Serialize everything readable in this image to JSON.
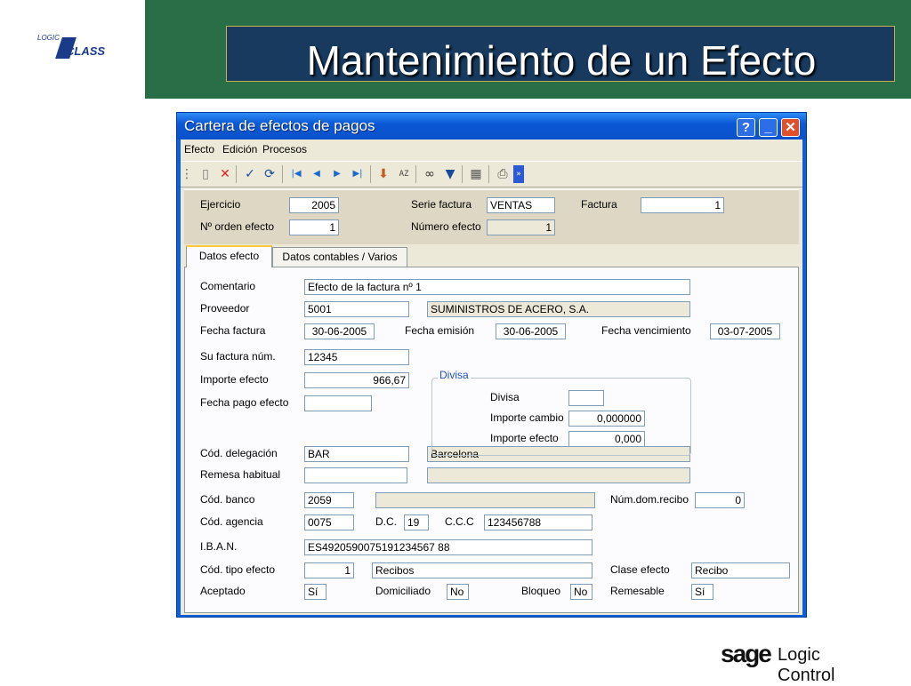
{
  "slide": {
    "title": "Mantenimiento de un Efecto"
  },
  "logo_top": {
    "logic": "LOGIC",
    "class": "CLASS"
  },
  "logo_bottom": {
    "sage": "sage",
    "logic_control": "Logic Control"
  },
  "window": {
    "title": "Cartera de efectos de pagos",
    "help": "?",
    "minimize": "_",
    "close": "✕"
  },
  "menu": [
    "Efecto",
    "Edición",
    "Procesos"
  ],
  "toolbar_icons": [
    "new-doc-icon",
    "delete-icon",
    "accept-icon",
    "refresh-icon",
    "first-record-icon",
    "previous-record-icon",
    "next-record-icon",
    "last-record-icon",
    "search-icon",
    "sort-az-icon",
    "glasses-icon",
    "filter-icon",
    "calendar-icon",
    "print-icon",
    "more-icon"
  ],
  "header": {
    "ejercicio_label": "Ejercicio",
    "ejercicio": "2005",
    "serie_label": "Serie factura",
    "serie": "VENTAS",
    "factura_label": "Factura",
    "factura": "1",
    "norden_label": "Nº orden efecto",
    "norden": "1",
    "numero_label": "Número efecto",
    "numero": "1"
  },
  "tabs": [
    "Datos efecto",
    "Datos contables / Varios"
  ],
  "form": {
    "comentario_label": "Comentario",
    "comentario": "Efecto de la factura nº 1",
    "proveedor_label": "Proveedor",
    "proveedor": "5001",
    "proveedor_nombre": "SUMINISTROS DE ACERO, S.A.",
    "fecha_factura_label": "Fecha factura",
    "fecha_factura": "30-06-2005",
    "fecha_emision_label": "Fecha emisión",
    "fecha_emision": "30-06-2005",
    "fecha_venc_label": "Fecha vencimiento",
    "fecha_venc": "03-07-2005",
    "su_factura_label": "Su factura núm.",
    "su_factura": "12345",
    "importe_label": "Importe efecto",
    "importe": "966,67",
    "fecha_pago_label": "Fecha pago efecto",
    "fecha_pago": "",
    "divisa_group": "Divisa",
    "divisa_label": "Divisa",
    "divisa": "",
    "importe_cambio_label": "Importe cambio",
    "importe_cambio": "0,000000",
    "importe_efecto_div_label": "Importe efecto",
    "importe_efecto_div": "0,000",
    "delegacion_label": "Cód. delegación",
    "delegacion": "BAR",
    "delegacion_nombre": "Barcelona",
    "remesa_label": "Remesa habitual",
    "remesa": "",
    "remesa_nombre": "",
    "banco_label": "Cód. banco",
    "banco": "2059",
    "banco_nombre": "",
    "num_dom_label": "Núm.dom.recibo",
    "num_dom": "0",
    "agencia_label": "Cód. agencia",
    "agencia": "0075",
    "dc_label": "D.C.",
    "dc": "19",
    "ccc_label": "C.C.C",
    "ccc": "123456788",
    "iban_label": "I.B.A.N.",
    "iban": "ES4920590075191234567 88",
    "tipo_label": "Cód. tipo efecto",
    "tipo": "1",
    "tipo_nombre": "Recibos",
    "clase_label": "Clase efecto",
    "clase": "Recibo",
    "aceptado_label": "Aceptado",
    "aceptado": "Sí",
    "domiciliado_label": "Domiciliado",
    "domiciliado": "No",
    "bloqueo_label": "Bloqueo",
    "bloqueo": "No",
    "remesable_label": "Remesable",
    "remesable": "Sí"
  }
}
